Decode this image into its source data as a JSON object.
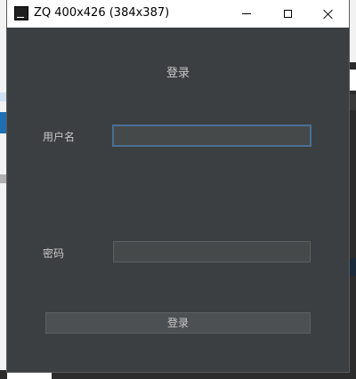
{
  "window": {
    "title": "ZQ 400x426 (384x387)",
    "app_icon_glyph": "IJ",
    "icons": [
      "minimize-icon",
      "maximize-icon",
      "close-icon"
    ]
  },
  "form": {
    "heading": "登录",
    "username_label": "用户名",
    "username_value": "",
    "password_label": "密码",
    "password_value": "",
    "submit_label": "登录"
  },
  "colors": {
    "window_bg": "#3c3f41",
    "titlebar_bg": "#ffffff",
    "focus_border": "#4a6f93",
    "text": "#c8c8c8"
  }
}
